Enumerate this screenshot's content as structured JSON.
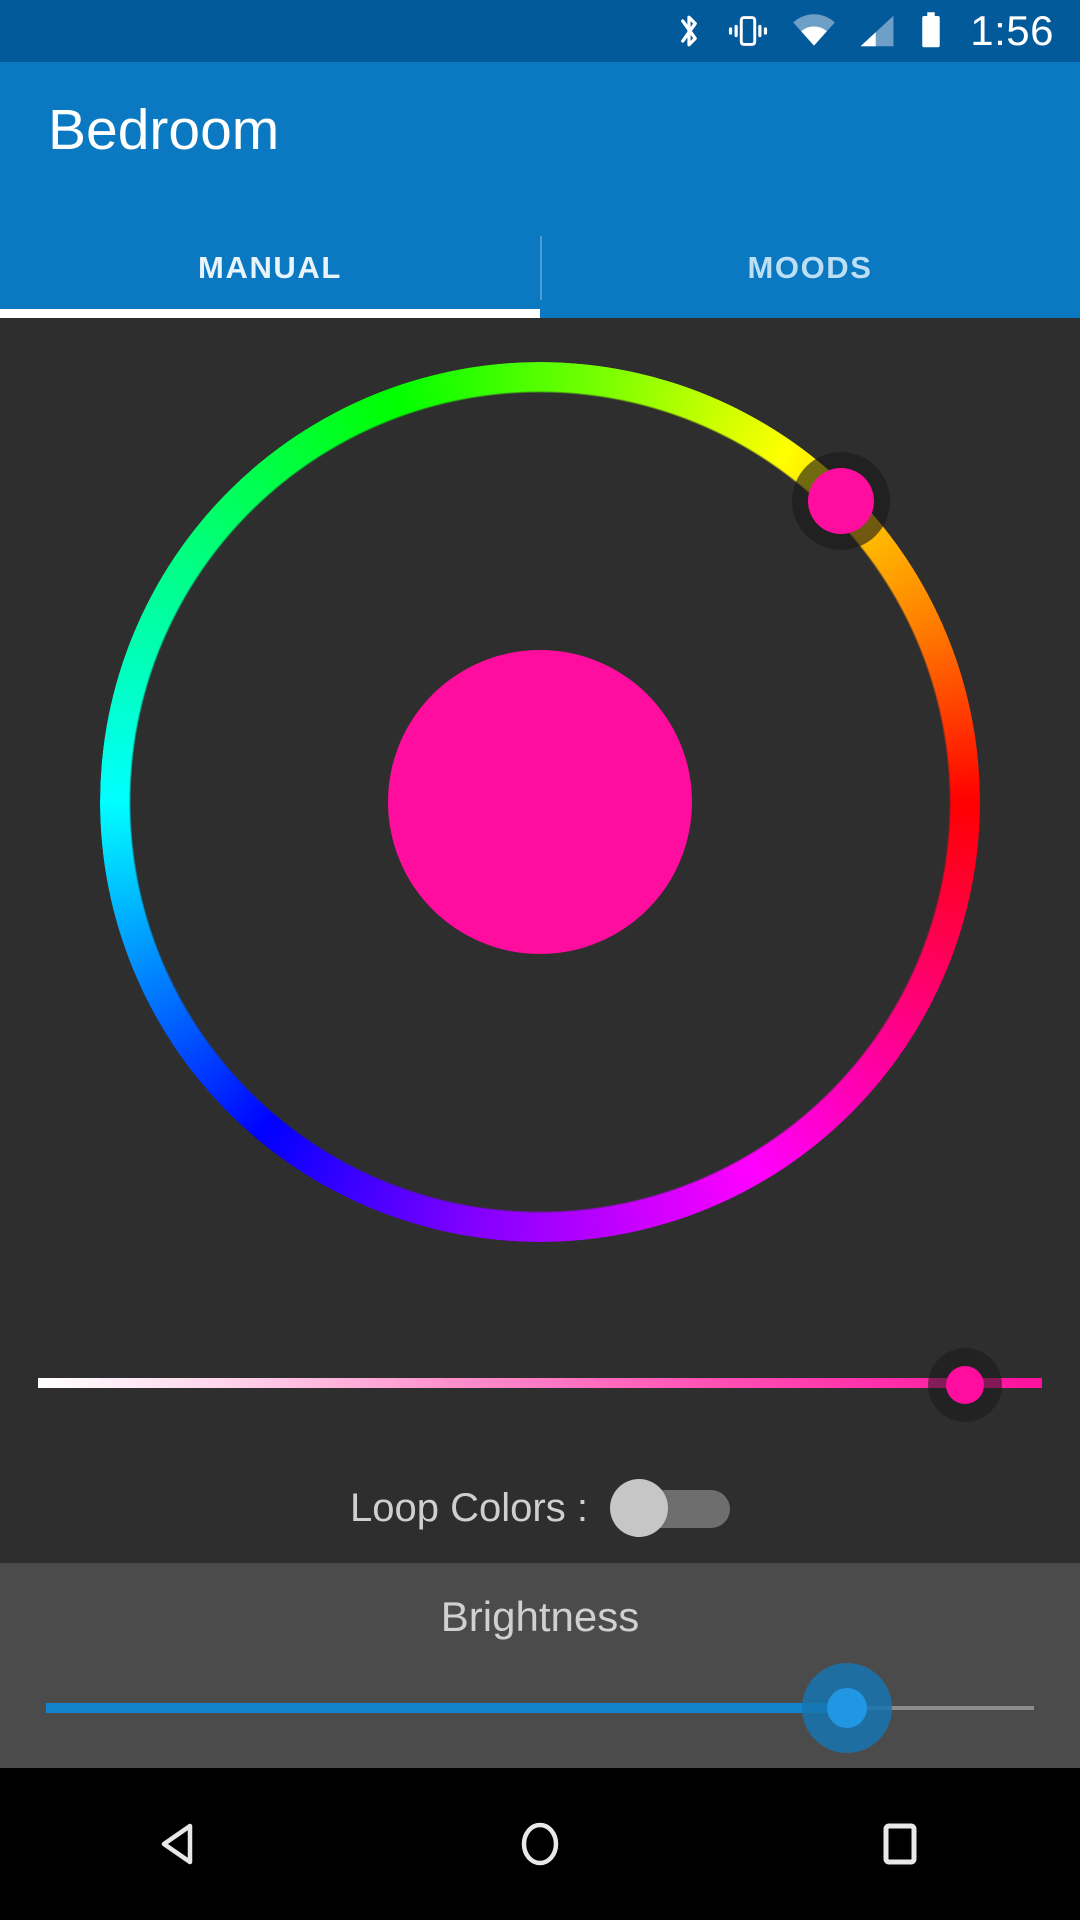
{
  "statusbar": {
    "time": "1:56",
    "icons": [
      {
        "name": "bluetooth-icon",
        "label": "Bluetooth"
      },
      {
        "name": "vibrate-icon",
        "label": "Vibrate"
      },
      {
        "name": "wifi-icon",
        "label": "Wi-Fi"
      },
      {
        "name": "cellular-signal-icon",
        "label": "Cellular signal"
      },
      {
        "name": "battery-icon",
        "label": "Battery full"
      }
    ],
    "background_color": "#035A9B"
  },
  "appbar": {
    "title": "Bedroom",
    "background_color": "#0B79C2",
    "tabs": [
      {
        "label": "MANUAL",
        "active": true
      },
      {
        "label": "MOODS",
        "active": false
      }
    ],
    "indicator_color": "#FFFFFF"
  },
  "main": {
    "background_color": "#2E2E2E",
    "color_wheel": {
      "name": "hue-color-wheel",
      "selected_color": "#FF0D9E",
      "thumb_angle_deg": 315,
      "preview_color": "#FF0D9E"
    },
    "saturation_slider": {
      "name": "saturation-slider",
      "value_percent": 93,
      "track_start_color": "#FFFFFF",
      "track_end_color": "#FF109E",
      "thumb_color": "#FF0D9E"
    },
    "loop_colors": {
      "label": "Loop Colors :",
      "enabled": false,
      "knob_color": "#C6C6C6",
      "track_color": "#6E6E6E"
    },
    "brightness": {
      "label": "Brightness",
      "value_percent": 81,
      "panel_color": "#4B4B4B",
      "fill_color": "#1184CE",
      "thumb_color": "#2196E3"
    }
  },
  "navbar": {
    "background_color": "#000000",
    "buttons": [
      {
        "name": "nav-back-button",
        "label": "Back"
      },
      {
        "name": "nav-home-button",
        "label": "Home"
      },
      {
        "name": "nav-recents-button",
        "label": "Recents"
      }
    ]
  }
}
